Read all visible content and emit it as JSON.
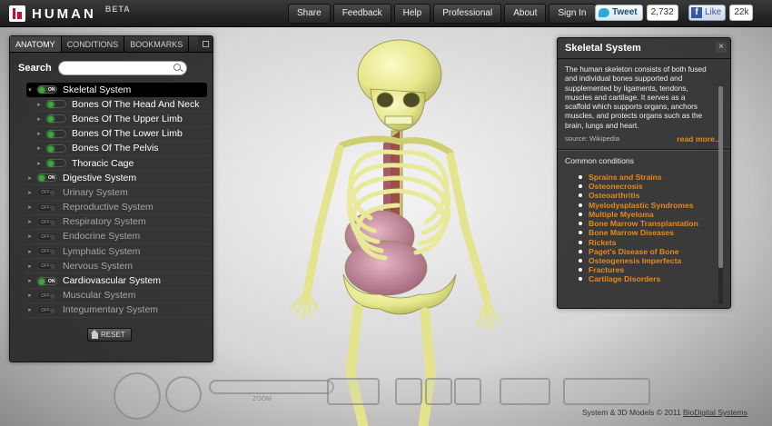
{
  "app": {
    "name": "HUMAN",
    "badge": "BETA"
  },
  "nav": [
    "Share",
    "Feedback",
    "Help",
    "Professional",
    "About",
    "Sign In"
  ],
  "social": {
    "tweet_label": "Tweet",
    "tweet_count": "2,732",
    "like_label": "Like",
    "like_count": "22k",
    "fb_letter": "f"
  },
  "left_panel": {
    "tabs": [
      "ANATOMY",
      "CONDITIONS",
      "BOOKMARKS"
    ],
    "search_label": "Search",
    "search_placeholder": "",
    "tree": [
      {
        "label": "Skeletal System",
        "toggle": "ON",
        "state": "on",
        "expanded": true,
        "selected": true,
        "level": 0
      },
      {
        "label": "Bones Of The Head And Neck",
        "toggle": "",
        "state": "on",
        "level": 1
      },
      {
        "label": "Bones Of The Upper Limb",
        "toggle": "",
        "state": "on",
        "level": 1
      },
      {
        "label": "Bones Of The Lower Limb",
        "toggle": "",
        "state": "on",
        "level": 1
      },
      {
        "label": "Bones Of The Pelvis",
        "toggle": "",
        "state": "on",
        "level": 1
      },
      {
        "label": "Thoracic Cage",
        "toggle": "",
        "state": "on",
        "level": 1
      },
      {
        "label": "Digestive System",
        "toggle": "ON",
        "state": "on",
        "level": 0
      },
      {
        "label": "Urinary System",
        "toggle": "OFF",
        "state": "off",
        "level": 0
      },
      {
        "label": "Reproductive System",
        "toggle": "OFF",
        "state": "off",
        "level": 0
      },
      {
        "label": "Respiratory System",
        "toggle": "OFF",
        "state": "off",
        "level": 0
      },
      {
        "label": "Endocrine System",
        "toggle": "OFF",
        "state": "off",
        "level": 0
      },
      {
        "label": "Lymphatic System",
        "toggle": "OFF",
        "state": "off",
        "level": 0
      },
      {
        "label": "Nervous System",
        "toggle": "OFF",
        "state": "off",
        "level": 0
      },
      {
        "label": "Cardiovascular System",
        "toggle": "ON",
        "state": "on",
        "level": 0
      },
      {
        "label": "Muscular System",
        "toggle": "OFF",
        "state": "off",
        "level": 0
      },
      {
        "label": "Integumentary System",
        "toggle": "OFF",
        "state": "off",
        "level": 0
      }
    ],
    "reset_label": "RESET"
  },
  "info_panel": {
    "title": "Skeletal System",
    "close_glyph": "×",
    "description": "The human skeleton consists of both fused and individual bones supported and supplemented by ligaments, tendons, muscles and cartilage. It serves as a scaffold which supports organs, anchors muscles, and protects organs such as the brain, lungs and heart.",
    "source": "source: Wikipedia",
    "read_more": "read more...",
    "conditions_title": "Common conditions",
    "conditions": [
      "Sprains and Strains",
      "Osteonecrosis",
      "Osteoarthritis",
      "Myelodysplastic Syndromes",
      "Multiple Myeloma",
      "Bone Marrow Transplantation",
      "Bone Marrow Diseases",
      "Rickets",
      "Paget's Disease of Bone",
      "Osteogenesis Imperfecta",
      "Fractures",
      "Cartilage Disorders"
    ]
  },
  "controls": {
    "zoom_label": "ZOOM"
  },
  "footer": {
    "text": "System & 3D Models © 2011 ",
    "link": "BioDigital Systems"
  },
  "colors": {
    "accent": "#e58a1a",
    "bone": "#eeeea0",
    "toggle_on": "#3aaa3a"
  }
}
